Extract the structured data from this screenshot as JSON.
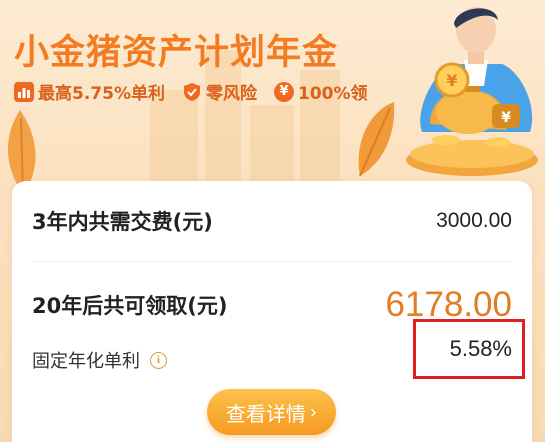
{
  "banner": {
    "title": "小金猪资产计划年金",
    "features": [
      {
        "icon": "chart-bars-icon",
        "glyph": "▮",
        "label": "最高5.75%单利"
      },
      {
        "icon": "shield-check-icon",
        "glyph": "✓",
        "label": "零风险"
      },
      {
        "icon": "yen-coin-icon",
        "glyph": "¥",
        "label": "100%领"
      }
    ]
  },
  "card": {
    "pay_label": "3年内共需交费(元)",
    "pay_value": "3000.00",
    "receive_label": "20年后共可领取(元)",
    "receive_value": "6178.00",
    "rate_label": "固定年化单利",
    "rate_value": "5.58%",
    "detail_button": "查看详情"
  },
  "colors": {
    "brand_orange": "#f37c23",
    "value_orange": "#e27c25",
    "highlight_red": "#e01f1f",
    "button_gradient_top": "#fcc24c",
    "button_gradient_bottom": "#f59a21"
  }
}
